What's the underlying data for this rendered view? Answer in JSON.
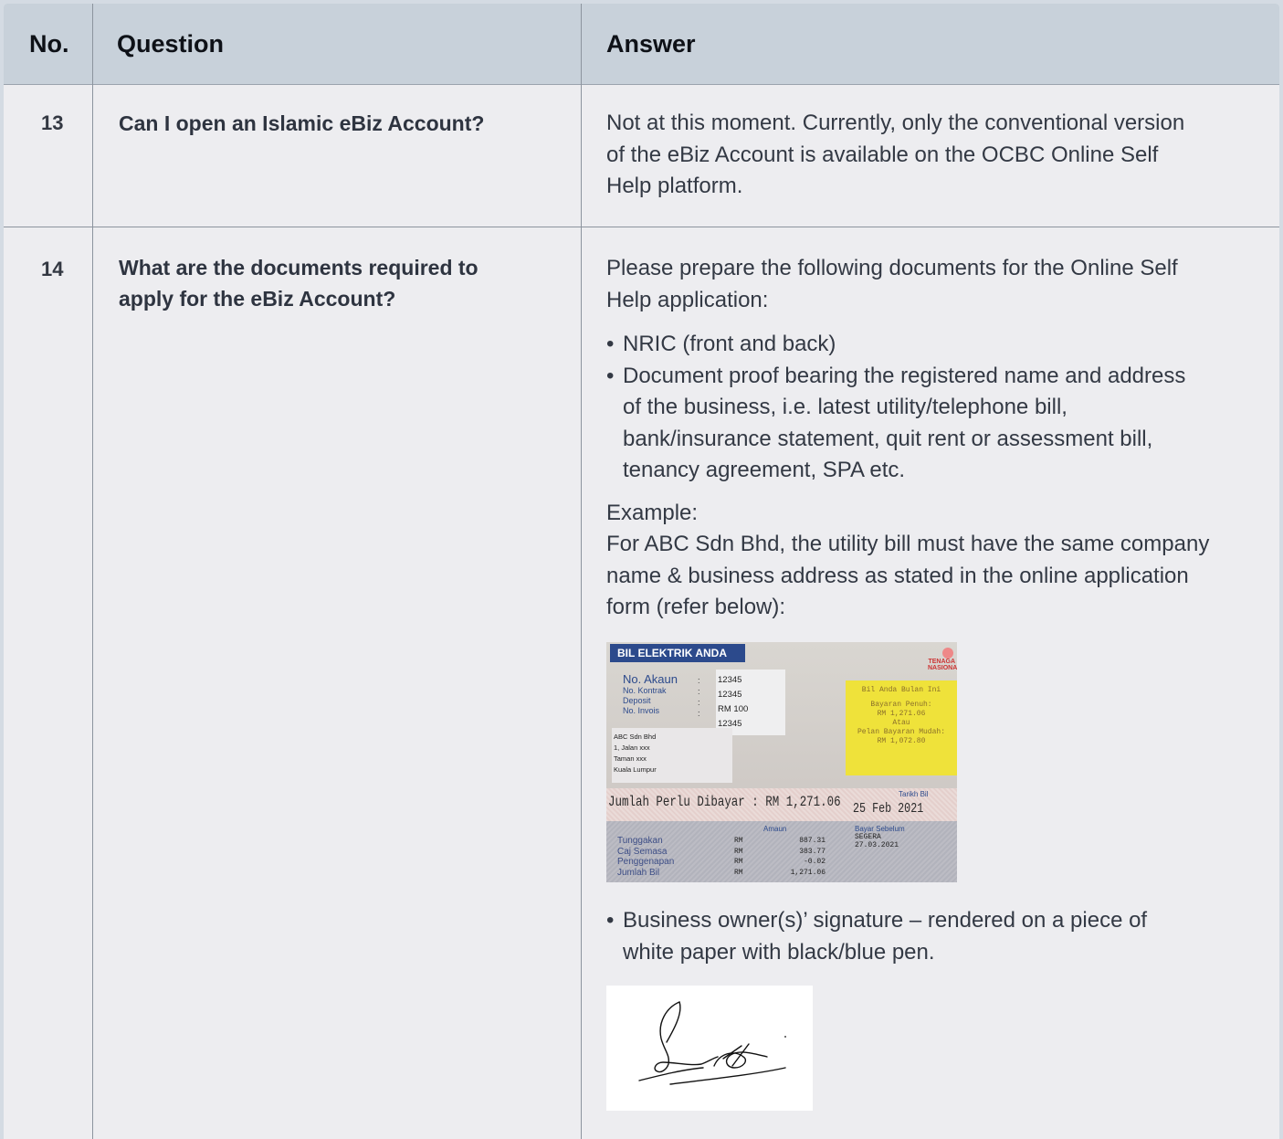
{
  "header": {
    "no": "No.",
    "question": "Question",
    "answer": "Answer"
  },
  "rows": [
    {
      "no": "13",
      "question": "Can I open an Islamic eBiz Account?",
      "answer_lines": [
        "Not at this moment. Currently, only the conventional version",
        "of the eBiz Account is available on the OCBC Online Self",
        "Help platform."
      ]
    },
    {
      "no": "14",
      "question_lines": [
        "What are the documents required to",
        "apply for the eBiz Account?"
      ],
      "intro_lines": [
        "Please prepare the following documents for the Online Self",
        "Help application:"
      ],
      "bullet1": "NRIC (front and back)",
      "bullet2_lines": [
        "Document proof bearing the registered name and address",
        "of the business, i.e. latest utility/telephone bill,",
        "bank/insurance statement, quit rent or assessment bill,",
        "tenancy agreement, SPA etc."
      ],
      "example_label": "Example:",
      "example_lines": [
        "For ABC Sdn Bhd, the utility bill must have the same company",
        "name & business address as stated in the online application",
        "form (refer below):"
      ],
      "bullet3_lines": [
        "Business owner(s)’ signature – rendered on a piece of",
        "white paper with black/blue pen."
      ]
    }
  ],
  "bill": {
    "title": "BIL ELEKTRIK ANDA",
    "logo_text": "TENAGA NASIONAL",
    "labels": [
      "No. Akaun",
      "No. Kontrak",
      "Deposit",
      "No. Invois"
    ],
    "values": [
      "12345",
      "12345",
      "RM 100",
      "12345"
    ],
    "address": [
      "ABC Sdn Bhd",
      "1, Jalan xxx",
      "Taman xxx",
      "Kuala Lumpur"
    ],
    "yellow": [
      "Bil Anda Bulan Ini",
      "Bayaran Penuh:",
      "RM 1,271.06",
      "Atau",
      "Pelan Bayaran Mudah:",
      "RM 1,072.80"
    ],
    "jumlah": "Jumlah Perlu Dibayar : RM 1,271.06",
    "tarikh_label": "Tarikh Bil",
    "tarikh": "25 Feb 2021",
    "amaun_label": "Amaun",
    "row_labels": [
      "Tunggakan",
      "Caj Semasa",
      "Penggenapan",
      "Jumlah Bil"
    ],
    "row_rm": [
      "RM",
      "RM",
      "RM",
      "RM"
    ],
    "row_amounts": [
      "887.31",
      "383.77",
      "-0.02",
      "1,271.06"
    ],
    "bayar_label": "Bayar Sebelum",
    "bayar_values": [
      "SEGERA",
      "27.03.2021"
    ]
  },
  "bullet_glyph": "•"
}
